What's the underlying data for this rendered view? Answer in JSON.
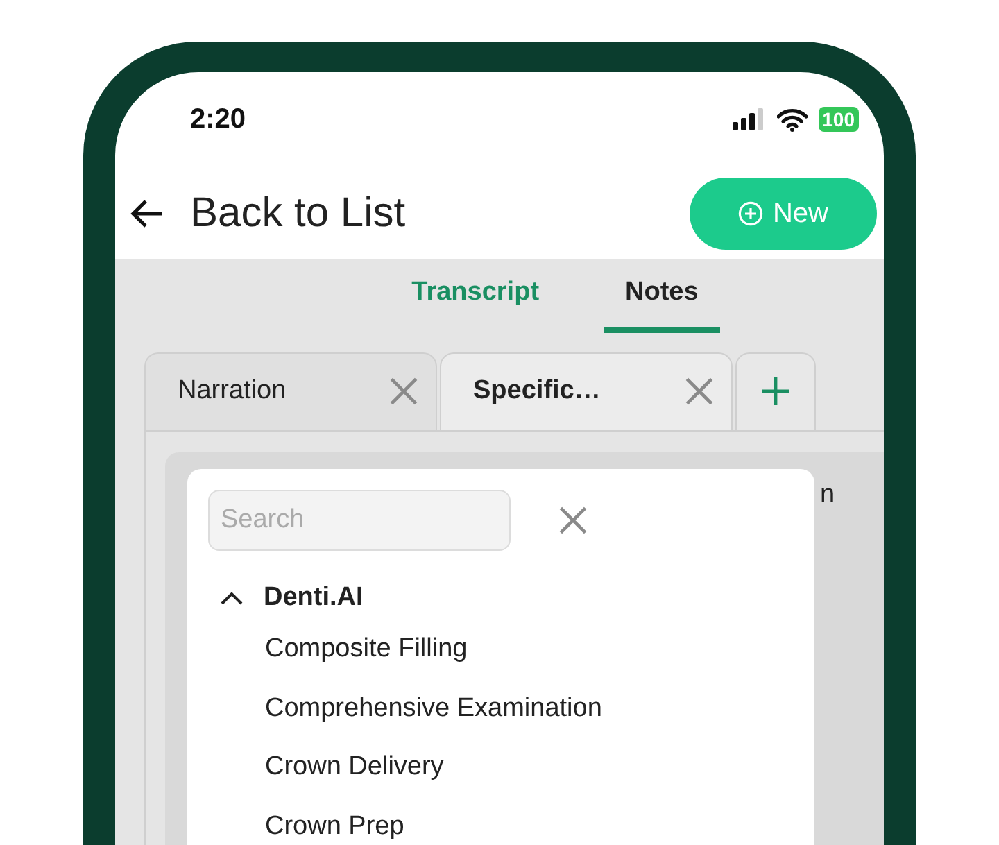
{
  "status_bar": {
    "time": "2:20",
    "battery": "100"
  },
  "header": {
    "back_label": "Back to List",
    "new_button": "New"
  },
  "view_tabs": [
    {
      "label": "Transcript",
      "selected": false
    },
    {
      "label": "Notes",
      "selected": true
    }
  ],
  "doc_tabs": [
    {
      "label": "Narration",
      "selected": false
    },
    {
      "label": "Specific…",
      "selected": true
    }
  ],
  "behind_text": "n",
  "picker": {
    "search": {
      "placeholder": "Search"
    },
    "groups": [
      {
        "label": "Denti.AI",
        "expanded": true,
        "children": [
          {
            "label": "Composite Filling"
          },
          {
            "label": "Comprehensive Examination"
          },
          {
            "label": "Crown Delivery"
          },
          {
            "label": "Crown Prep"
          }
        ]
      }
    ]
  }
}
